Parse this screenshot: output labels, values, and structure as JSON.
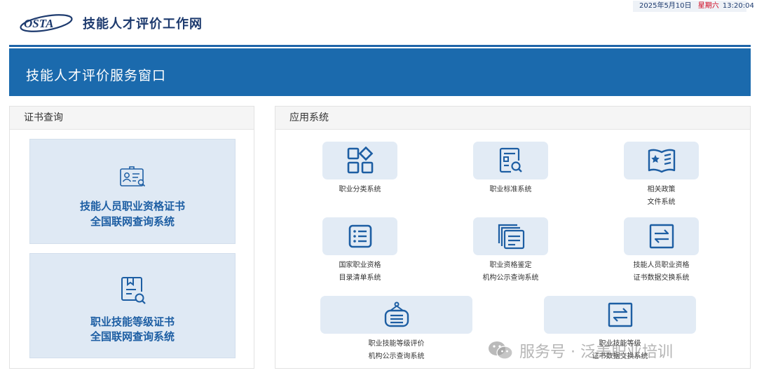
{
  "header": {
    "logo_text": "OSTA",
    "site_title": "技能人才评价工作网",
    "date": "2025年5月10日",
    "weekday": "星期六",
    "time": "13:20:04"
  },
  "banner": {
    "title": "技能人才评价服务窗口"
  },
  "cert_panel": {
    "title": "证书查询",
    "cards": [
      {
        "line1": "技能人员职业资格证书",
        "line2": "全国联网查询系统",
        "icon": "certificate-id-icon"
      },
      {
        "line1": "职业技能等级证书",
        "line2": "全国联网查询系统",
        "icon": "document-search-icon"
      }
    ]
  },
  "apps_panel": {
    "title": "应用系统",
    "apps": [
      {
        "line1": "职业分类系统",
        "line2": "",
        "icon": "category-grid-icon"
      },
      {
        "line1": "职业标准系统",
        "line2": "",
        "icon": "standard-search-icon"
      },
      {
        "line1": "相关政策",
        "line2": "文件系统",
        "icon": "policy-book-icon"
      },
      {
        "line1": "国家职业资格",
        "line2": "目录清单系统",
        "icon": "list-icon"
      },
      {
        "line1": "职业资格鉴定",
        "line2": "机构公示查询系统",
        "icon": "stacked-docs-icon"
      },
      {
        "line1": "技能人员职业资格",
        "line2": "证书数据交换系统",
        "icon": "exchange-icon"
      },
      {
        "line1": "职业技能等级评价",
        "line2": "机构公示查询系统",
        "icon": "institution-sign-icon"
      },
      {
        "line1": "职业技能等级",
        "line2": "证书数据交换系统",
        "icon": "exchange-icon"
      }
    ]
  },
  "watermark": {
    "text": "服务号 · 泛美职业培训",
    "icon": "wechat-icon"
  },
  "colors": {
    "brand_blue": "#1b6aad",
    "card_bg": "#dfe9f4",
    "icon_blue": "#1d5ea3",
    "weekday_red": "#d0021b"
  }
}
